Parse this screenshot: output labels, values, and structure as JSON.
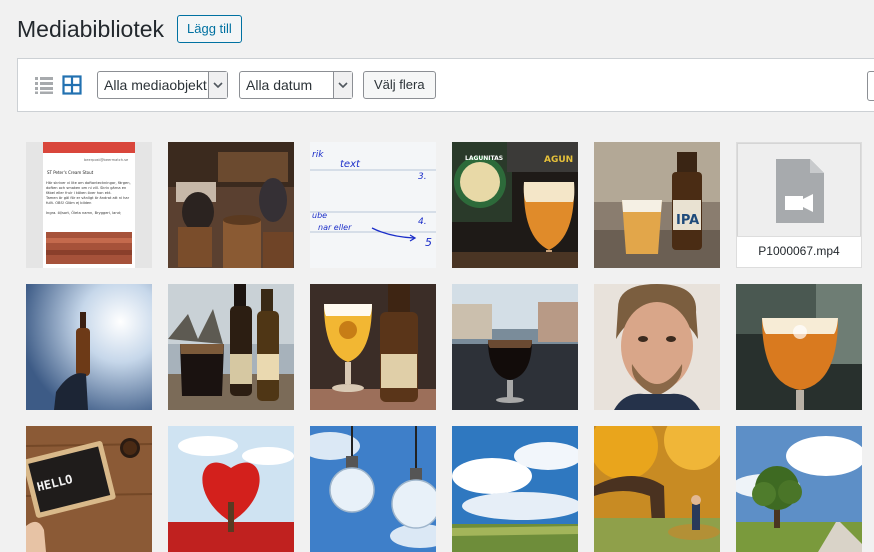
{
  "header": {
    "title": "Mediabibliotek",
    "add_new": "Lägg till"
  },
  "toolbar": {
    "filter_type": "Alla mediaobjekt",
    "filter_date": "Alla datum",
    "bulk_select": "Välj flera"
  },
  "media": {
    "tiles": [
      {
        "kind": "image",
        "subject": "email screenshot",
        "text": [
          "beerpost@beermatch.se",
          "ST Peter's Cream Stout",
          "Här skriver vi lite om doftanteckningar, färgen, doften och smaken om ni vill. Skriv gärna en fäbel eller fruir i köken över hon ekt.",
          "Tamen är gäl för er vänligt är ändrat att ni har fullt. OBS! Glöm ej bilden",
          "Ingra. öl/sort, Öleta namn, Bryggeri, land;"
        ]
      },
      {
        "kind": "image",
        "subject": "pub interior with barrels"
      },
      {
        "kind": "image",
        "subject": "handwritten whiteboard notes",
        "text": [
          "rik",
          "text",
          "3.",
          "4.",
          "5",
          "ube",
          "nar eller"
        ]
      },
      {
        "kind": "image",
        "subject": "beer glass with Lagunitas sign",
        "text": [
          "LAGUNITAS",
          "AGUN"
        ]
      },
      {
        "kind": "image",
        "subject": "IPA bottle and glass",
        "text": [
          "IPA"
        ]
      },
      {
        "kind": "video",
        "filename": "P1000067.mp4",
        "icon": "video-file-icon"
      },
      {
        "kind": "image",
        "subject": "beer bottle against sky"
      },
      {
        "kind": "image",
        "subject": "stout glass and bottle"
      },
      {
        "kind": "image",
        "subject": "pale ale and bottle"
      },
      {
        "kind": "image",
        "subject": "dark beer outdoors"
      },
      {
        "kind": "image",
        "subject": "portrait of man"
      },
      {
        "kind": "image",
        "subject": "amber beer in tulip glass"
      },
      {
        "kind": "image",
        "subject": "hello letter board on wood",
        "text": [
          "HELLO"
        ]
      },
      {
        "kind": "image",
        "subject": "red heart tree"
      },
      {
        "kind": "image",
        "subject": "light bulbs against sky"
      },
      {
        "kind": "image",
        "subject": "field with clouds"
      },
      {
        "kind": "image",
        "subject": "autumn trees"
      },
      {
        "kind": "image",
        "subject": "tree on country road"
      }
    ]
  },
  "colors": {
    "accent": "#0071a1",
    "background": "#f1f1f1",
    "panel": "#ffffff"
  }
}
